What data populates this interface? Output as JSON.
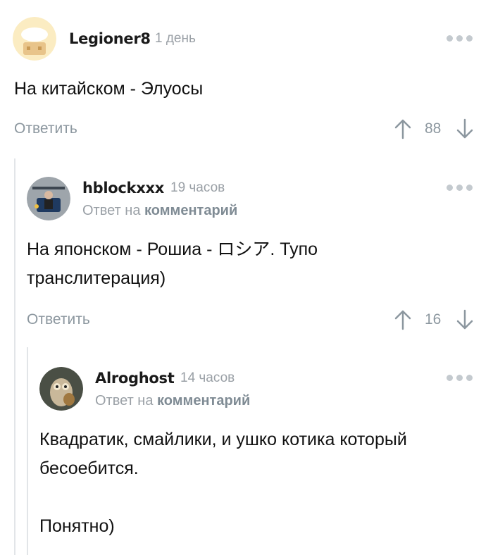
{
  "comments": [
    {
      "username": "Legioner8",
      "time": "1 день",
      "text_lines": [
        "На китайском - Элуосы"
      ],
      "reply_label": "Ответить",
      "rating": "88"
    },
    {
      "username": "hblockxxx",
      "time": "19 часов",
      "reply_to_prefix": "Ответ на",
      "reply_to_link": "комментарий",
      "text_lines": [
        "На японском - Рошиа - ロシア. Тупо",
        "транслитерация)"
      ],
      "reply_label": "Ответить",
      "rating": "16"
    },
    {
      "username": "Alroghost",
      "time": "14 часов",
      "reply_to_prefix": "Ответ на",
      "reply_to_link": "комментарий",
      "text_lines": [
        "Квадратик, смайлики, и ушко котика который",
        "бесоебится.",
        "",
        "Понятно)"
      ]
    }
  ],
  "colors": {
    "meta": "#9aa0a6",
    "action": "#8c979f",
    "thread_line": "#e2e5e8",
    "dots": "#c4cacf"
  },
  "icons": [
    "more-dots-icon",
    "upvote-arrow-icon",
    "downvote-arrow-icon"
  ]
}
